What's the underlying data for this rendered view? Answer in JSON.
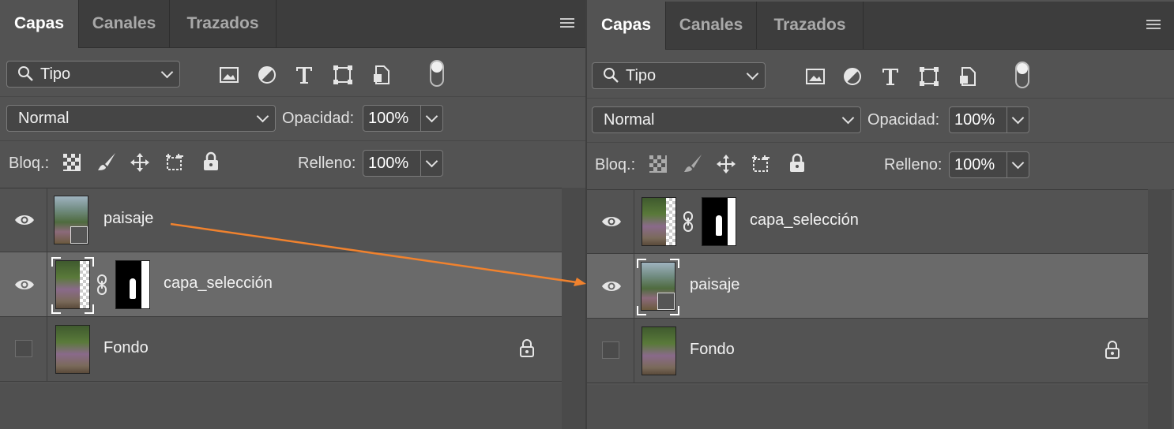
{
  "colors": {
    "panel_bg": "#535353",
    "tabbar_bg": "#3d3d3d",
    "selected_row": "#6a6a6a",
    "arrow": "#f0822e"
  },
  "panels": [
    {
      "tabs": [
        "Capas",
        "Canales",
        "Trazados"
      ],
      "filter": {
        "label": "Tipo",
        "icon": "search-icon"
      },
      "blend_mode": "Normal",
      "opacity_label": "Opacidad:",
      "opacity_value": "100%",
      "lock_label": "Bloq.:",
      "fill_label": "Relleno:",
      "fill_value": "100%",
      "layers": [
        {
          "name": "paisaje",
          "visible": true,
          "selected": false,
          "type": "smart-object"
        },
        {
          "name": "capa_selección",
          "visible": true,
          "selected": true,
          "type": "masked"
        },
        {
          "name": "Fondo",
          "visible": false,
          "selected": false,
          "type": "background",
          "locked": true
        }
      ]
    },
    {
      "tabs": [
        "Capas",
        "Canales",
        "Trazados"
      ],
      "filter": {
        "label": "Tipo",
        "icon": "search-icon"
      },
      "blend_mode": "Normal",
      "opacity_label": "Opacidad:",
      "opacity_value": "100%",
      "lock_label": "Bloq.:",
      "fill_label": "Relleno:",
      "fill_value": "100%",
      "layers": [
        {
          "name": "capa_selección",
          "visible": true,
          "selected": false,
          "type": "masked"
        },
        {
          "name": "paisaje",
          "visible": true,
          "selected": true,
          "type": "smart-object"
        },
        {
          "name": "Fondo",
          "visible": false,
          "selected": false,
          "type": "background",
          "locked": true
        }
      ]
    }
  ]
}
